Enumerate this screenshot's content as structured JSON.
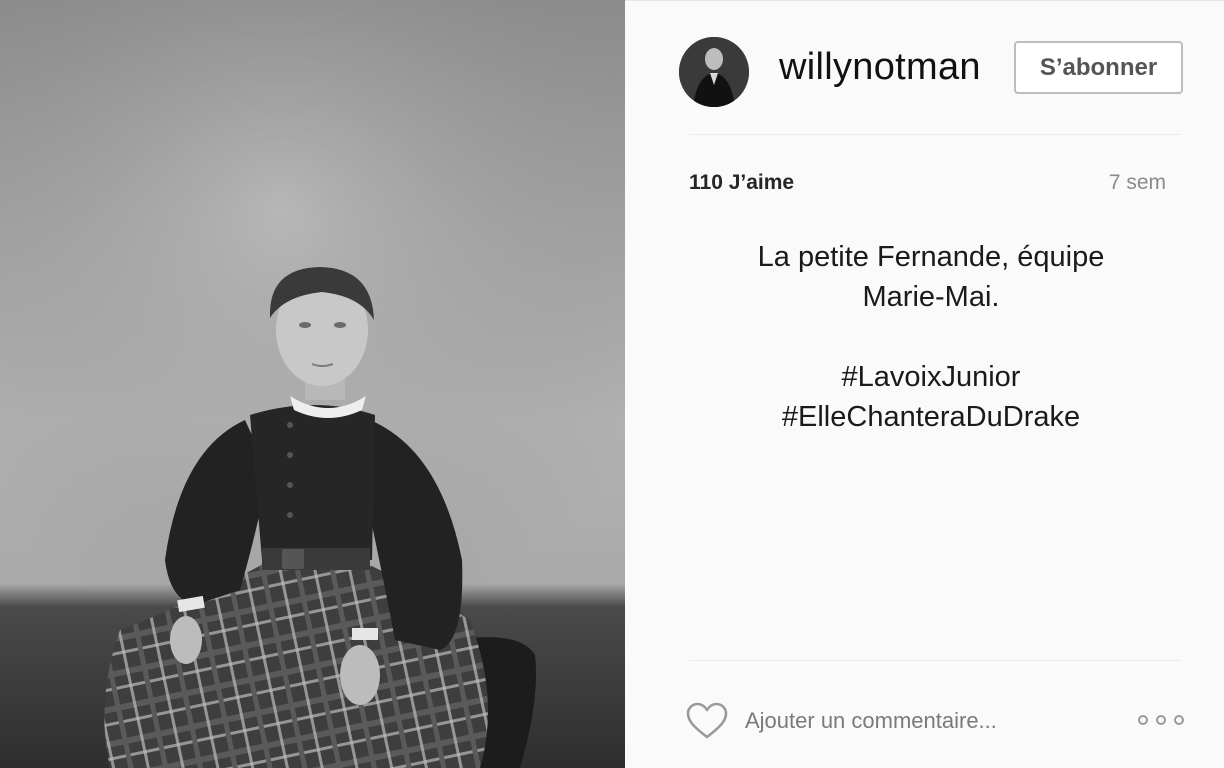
{
  "post": {
    "username": "willynotman",
    "follow_label": "S’abonner",
    "likes": "110 J’aime",
    "age": "7 sem",
    "caption_lines": [
      "La petite Fernande, équipe",
      "Marie-Mai.",
      "",
      "#LavoixJunior",
      "#ElleChanteraDuDrake"
    ]
  },
  "footer": {
    "comment_placeholder": "Ajouter un commentaire..."
  },
  "icons": {
    "like": "heart-icon",
    "options": "more-options-icon",
    "avatar": "avatar"
  },
  "colors": {
    "panel_background": "#fafafa",
    "follow_border": "#bdbdbd",
    "muted_text": "#8a8a8a"
  }
}
